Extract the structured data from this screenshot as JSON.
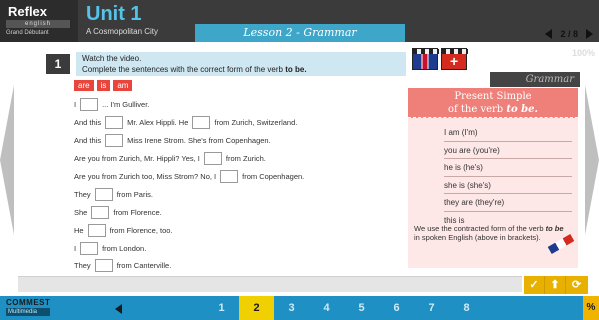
{
  "header": {
    "logo_main": "Reflex",
    "logo_sub": "english",
    "logo_level": "Grand Débutant",
    "unit_title": "Unit 1",
    "unit_subtitle": "A Cosmopolitan City",
    "lesson": "Lesson 2 - Grammar",
    "page_indicator": "2 / 8"
  },
  "exercise": {
    "number": "1",
    "instruction_line1": "Watch the video.",
    "instruction_line2_prefix": "Complete the sentences with the correct form of the verb ",
    "instruction_line2_bold": "to be.",
    "options": [
      "are",
      "is",
      "am"
    ],
    "sentences": [
      {
        "before": "I",
        "after": "... I'm Gulliver."
      },
      {
        "before": "And this",
        "after": "Mr. Alex Hippli. He",
        "gap2_after": "from Zurich, Switzerland."
      },
      {
        "before": "And this",
        "after": "Miss Irene Strom. She's from Copenhagen."
      },
      {
        "before": "Are you from Zurich, Mr. Hippli? Yes, I",
        "after": "from Zurich."
      },
      {
        "before": "Are you from Zurich too, Miss Strom? No, I",
        "after": "from Copenhagen."
      },
      {
        "before": "They",
        "after": "from Paris."
      },
      {
        "before": "She",
        "after": "from Florence."
      },
      {
        "before": "He",
        "after": "from Florence, too."
      },
      {
        "before": "I",
        "after": "from London."
      },
      {
        "before": "They",
        "after": "from Canterville."
      }
    ]
  },
  "grammar": {
    "tab_label": "Grammar",
    "title_line1": "Present Simple",
    "title_line2_prefix": "of the verb ",
    "title_line2_italic": "to be.",
    "forms": [
      "I am (I'm)",
      "you are (you're)",
      "he is (he's)",
      "she is (she's)",
      "they are (they're)",
      "this is"
    ],
    "note_prefix": "We use the contracted form of the verb ",
    "note_bold": "to be",
    "note_suffix": " in spoken English (above in brackets)."
  },
  "watermark": "100%",
  "actions": {
    "check": "✓",
    "up": "⬆",
    "reset": "⟳"
  },
  "footer": {
    "brand": "COMMEST",
    "brand_sub": "Multimedia",
    "pages": [
      "1",
      "2",
      "3",
      "4",
      "5",
      "6",
      "7",
      "8"
    ],
    "active_page": "2",
    "percent": "%"
  }
}
